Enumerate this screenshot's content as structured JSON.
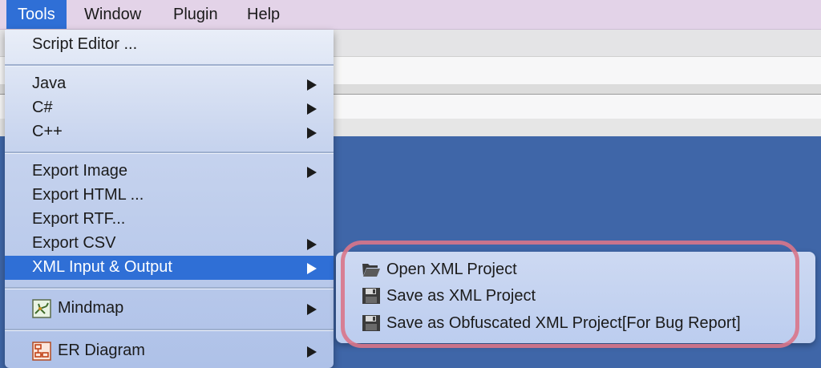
{
  "menubar": {
    "items": [
      {
        "label": "Tools"
      },
      {
        "label": "Window"
      },
      {
        "label": "Plugin"
      },
      {
        "label": "Help"
      }
    ]
  },
  "tools_menu": {
    "script_editor": "Script Editor ...",
    "java": "Java",
    "csharp": "C#",
    "cpp": "C++",
    "export_image": "Export Image",
    "export_html": "Export HTML ...",
    "export_rtf": "Export RTF...",
    "export_csv": "Export CSV",
    "xml_io": "XML Input & Output",
    "mindmap": "Mindmap",
    "er_diagram": "ER Diagram"
  },
  "xml_submenu": {
    "open": "Open XML Project",
    "save": "Save as XML Project",
    "save_obfuscated": "Save as Obfuscated XML Project[For Bug Report]"
  },
  "colors": {
    "selection": "#2f6fd6",
    "highlight_ring": "#d9758a",
    "canvas": "#3f66a8"
  }
}
